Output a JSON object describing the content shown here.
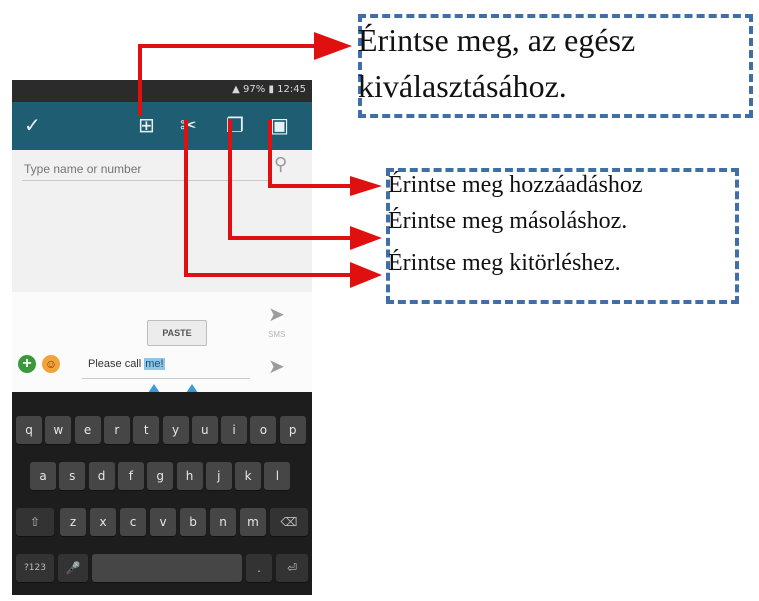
{
  "callouts": {
    "select_all_line1": "Érintse meg, az egész",
    "select_all_line2": "kiválasztásához.",
    "add": "Érintse meg hozzáadáshoz",
    "copy": "Érintse meg másoláshoz.",
    "delete": "Érintse meg kitörléshez."
  },
  "phone": {
    "status": {
      "battery_percent": "97%",
      "time": "12:45"
    },
    "action_bar": {
      "done_icon": "check-icon",
      "select_all_icon": "select-all-icon",
      "cut_icon": "cut-icon",
      "copy_icon": "copy-icon",
      "paste_icon": "paste-icon"
    },
    "recipient_placeholder": "Type name or number",
    "paste_label": "PASTE",
    "send_label": "SMS",
    "message_prefix": "Please call ",
    "message_selected": "me!",
    "keyboard": {
      "row1": [
        "q",
        "w",
        "e",
        "r",
        "t",
        "y",
        "u",
        "i",
        "o",
        "p"
      ],
      "row2": [
        "a",
        "s",
        "d",
        "f",
        "g",
        "h",
        "j",
        "k",
        "l"
      ],
      "row3": [
        "z",
        "x",
        "c",
        "v",
        "b",
        "n",
        "m"
      ],
      "shift": "⇧",
      "backspace": "⌫",
      "symbols": "?123",
      "mic": "🎤",
      "period": ".",
      "enter": "⏎"
    }
  },
  "colors": {
    "arrow": "#e01010",
    "callout_border": "#3f6fa6",
    "action_bar": "#1f5d72"
  }
}
